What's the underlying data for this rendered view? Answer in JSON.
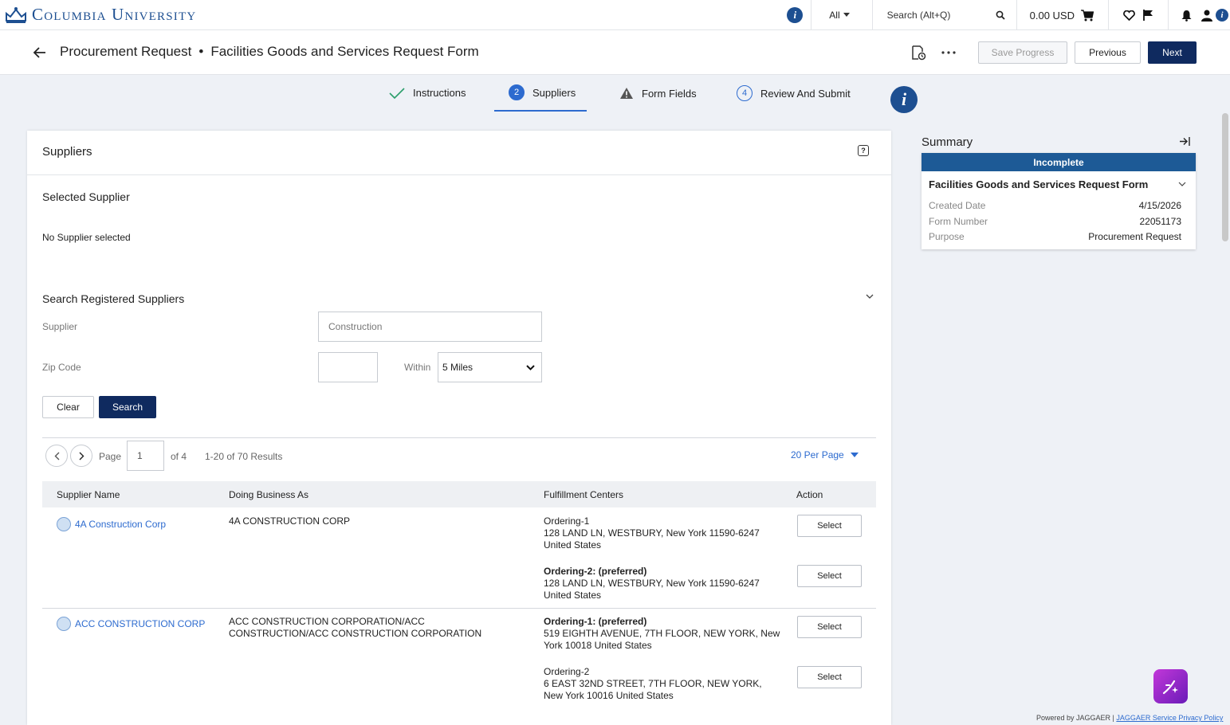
{
  "brand": {
    "name": "Columbia University"
  },
  "topbar": {
    "scope": "All",
    "search_placeholder": "Search (Alt+Q)",
    "cart_total": "0.00 USD"
  },
  "header": {
    "title": "Procurement Request",
    "separator": "•",
    "subtitle": "Facilities Goods and Services Request Form",
    "save_label": "Save Progress",
    "previous_label": "Previous",
    "next_label": "Next"
  },
  "steps": [
    {
      "label": "Instructions",
      "state": "done"
    },
    {
      "num": "2",
      "label": "Suppliers",
      "state": "active"
    },
    {
      "label": "Form Fields",
      "state": "warning"
    },
    {
      "num": "4",
      "label": "Review And Submit",
      "state": "pending"
    }
  ],
  "panel": {
    "title": "Suppliers",
    "selected_title": "Selected Supplier",
    "no_supplier": "No Supplier selected",
    "search_title": "Search Registered Suppliers",
    "supplier_label": "Supplier",
    "supplier_value": "Construction",
    "zip_label": "Zip Code",
    "zip_value": "",
    "within_label": "Within",
    "within_value": "5 Miles",
    "clear_label": "Clear",
    "search_label": "Search"
  },
  "pager": {
    "page_label": "Page",
    "page_value": "1",
    "of_label": "of 4",
    "results": "1-20 of 70 Results",
    "per_page": "20 Per Page"
  },
  "table": {
    "headers": [
      "Supplier Name",
      "Doing Business As",
      "Fulfillment Centers",
      "Action"
    ],
    "rows": [
      {
        "name": "4A Construction Corp",
        "dba": "4A CONSTRUCTION CORP",
        "centers": [
          {
            "title": "Ordering-1",
            "preferred": false,
            "line1": "128 LAND LN, WESTBURY, New York 11590-6247",
            "line2": "United States",
            "action": "Select"
          },
          {
            "title": "Ordering-2: (preferred)",
            "preferred": true,
            "line1": "128 LAND LN, WESTBURY, New York 11590-6247",
            "line2": "United States",
            "action": "Select"
          }
        ]
      },
      {
        "name": "ACC CONSTRUCTION CORP",
        "dba": "ACC CONSTRUCTION CORPORATION/ACC CONSTRUCTION/ACC CONSTRUCTION CORPORATION",
        "centers": [
          {
            "title": "Ordering-1: (preferred)",
            "preferred": true,
            "line1": "519 EIGHTH AVENUE, 7TH FLOOR, NEW YORK, New",
            "line2": "York 10018 United States",
            "action": "Select"
          },
          {
            "title": "Ordering-2",
            "preferred": false,
            "line1": "6 EAST 32ND STREET, 7TH FLOOR, NEW YORK,",
            "line2": "New York 10016 United States",
            "action": "Select"
          }
        ]
      }
    ]
  },
  "summary": {
    "title": "Summary",
    "status": "Incomplete",
    "form_name": "Facilities Goods and Services Request Form",
    "rows": [
      {
        "key": "Created Date",
        "value": "4/15/2026"
      },
      {
        "key": "Form Number",
        "value": "22051173"
      },
      {
        "key": "Purpose",
        "value": "Procurement Request"
      }
    ]
  },
  "footer": {
    "powered": "Powered by JAGGAER |",
    "link": "JAGGAER Service Privacy Policy"
  },
  "colors": {
    "brand_blue": "#1d4f91",
    "primary_button": "#0f2a5f",
    "accent": "#2d6bcf",
    "status_bar": "#1d5a96"
  }
}
